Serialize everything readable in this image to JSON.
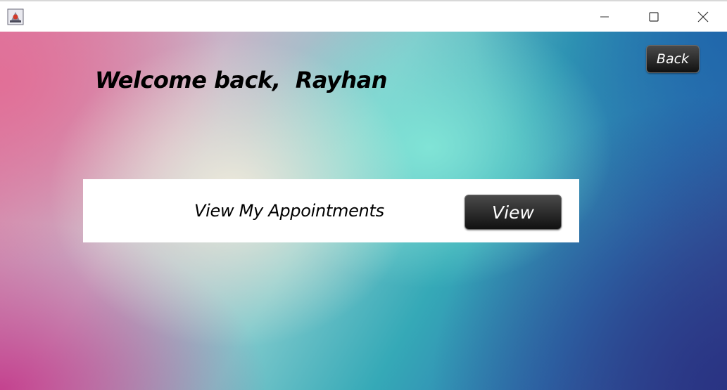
{
  "window": {
    "title": "",
    "controls": {
      "minimize_icon": "minimize-icon",
      "maximize_icon": "maximize-icon",
      "close_icon": "close-icon"
    },
    "app_icon": "java-app-icon"
  },
  "main": {
    "welcome_text": "Welcome back,  Rayhan",
    "back_label": "Back",
    "appointments": {
      "label": "View My Appointments",
      "button_label": "View"
    }
  },
  "colors": {
    "button_bg": "#1a1a1a",
    "button_text": "#ffffff",
    "card_bg": "#ffffff"
  }
}
